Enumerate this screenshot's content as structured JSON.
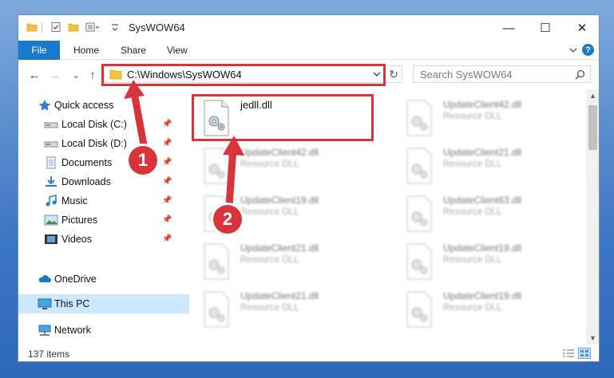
{
  "window": {
    "title": "SysWOW64",
    "controls": {
      "minimize": "—",
      "maximize": "☐",
      "close": "✕"
    }
  },
  "ribbon": {
    "tabs": [
      {
        "label": "File",
        "active": true
      },
      {
        "label": "Home"
      },
      {
        "label": "Share"
      },
      {
        "label": "View"
      }
    ],
    "help_label": "?"
  },
  "nav": {
    "back": "←",
    "forward": "→",
    "recent": "⌄",
    "up": "↑",
    "address": "C:\\Windows\\SysWOW64",
    "refresh": "↻",
    "search_placeholder": "Search SysWOW64"
  },
  "sidebar": {
    "items": [
      {
        "label": "Quick access",
        "icon": "star-icon"
      },
      {
        "label": "Local Disk (C:)",
        "icon": "drive-icon",
        "pinned": true
      },
      {
        "label": "Local Disk (D:)",
        "icon": "drive-icon",
        "pinned": true
      },
      {
        "label": "Documents",
        "icon": "documents-icon",
        "pinned": true
      },
      {
        "label": "Downloads",
        "icon": "downloads-icon",
        "pinned": true
      },
      {
        "label": "Music",
        "icon": "music-icon",
        "pinned": true
      },
      {
        "label": "Pictures",
        "icon": "pictures-icon",
        "pinned": true
      },
      {
        "label": "Videos",
        "icon": "videos-icon",
        "pinned": true
      },
      {
        "label": "OneDrive",
        "icon": "onedrive-icon"
      },
      {
        "label": "This PC",
        "icon": "this-pc-icon",
        "selected": true
      },
      {
        "label": "Network",
        "icon": "network-icon"
      }
    ]
  },
  "files": [
    {
      "name": "jedll.dll",
      "type": "",
      "highlighted": true
    },
    {
      "name": "UpdateClient42.dll",
      "type": "Resource DLL"
    },
    {
      "name": "UpdateClient42.dll",
      "type": "Resource DLL"
    },
    {
      "name": "UpdateClient21.dll",
      "type": "Resource DLL"
    },
    {
      "name": "UpdateClient19.dll",
      "type": "Resource DLL"
    },
    {
      "name": "UpdateClient63.dll",
      "type": "Resource DLL"
    },
    {
      "name": "UpdateClient21.dll",
      "type": "Resource DLL"
    },
    {
      "name": "UpdateClient19.dll",
      "type": "Resource DLL"
    },
    {
      "name": "UpdateClient21.dll",
      "type": "Resource DLL"
    },
    {
      "name": "UpdateClient19.dll",
      "type": "Resource DLL"
    }
  ],
  "status": {
    "items_count": "137 items"
  },
  "annotations": {
    "step1": "1",
    "step2": "2",
    "color": "#d9343b"
  }
}
